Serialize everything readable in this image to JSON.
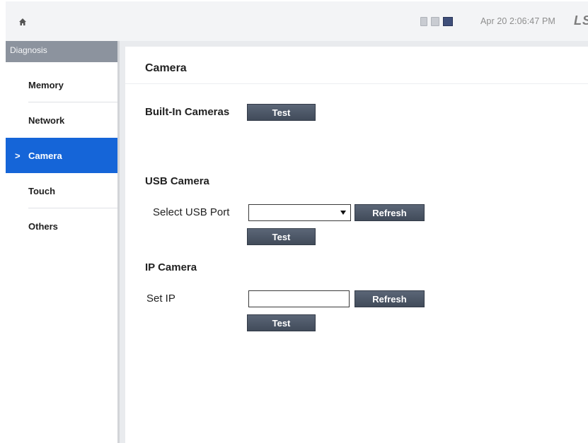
{
  "topbar": {
    "home_icon": "home-icon",
    "status_icons": [
      "sd-card-icon",
      "storage-icon",
      "network-icon"
    ],
    "clock": "Apr 20 2:06:47 PM",
    "logo_text": "LS"
  },
  "sidebar": {
    "header": "Diagnosis",
    "items": [
      {
        "label": "Memory",
        "active": false
      },
      {
        "label": "Network",
        "active": false
      },
      {
        "label": "Camera",
        "active": true
      },
      {
        "label": "Touch",
        "active": false
      },
      {
        "label": "Others",
        "active": false
      }
    ],
    "active_marker": ">"
  },
  "main": {
    "title": "Camera",
    "builtin": {
      "label": "Built-In Cameras",
      "test_button": "Test"
    },
    "usb": {
      "section_label": "USB Camera",
      "port_label": "Select USB Port",
      "port_value": "",
      "refresh_button": "Refresh",
      "test_button": "Test"
    },
    "ip": {
      "section_label": "IP Camera",
      "ip_label": "Set IP",
      "ip_value": "",
      "refresh_button": "Refresh",
      "test_button": "Test"
    }
  },
  "colors": {
    "accent": "#1565d8",
    "button": "#4a5463",
    "sidebar_header": "#8c939e",
    "content_bg": "#e9ebee"
  }
}
